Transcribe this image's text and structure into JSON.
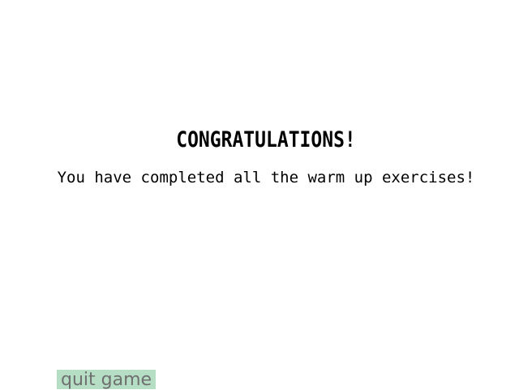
{
  "screen": {
    "title": "CONGRATULATIONS!",
    "message": "You have completed all the warm up exercises!"
  },
  "buttons": {
    "quit_label": "quit game"
  },
  "colors": {
    "background": "#ffffff",
    "text": "#000000",
    "quit_button_bg": "#b5dec5",
    "quit_button_text": "#6f6f6f"
  }
}
